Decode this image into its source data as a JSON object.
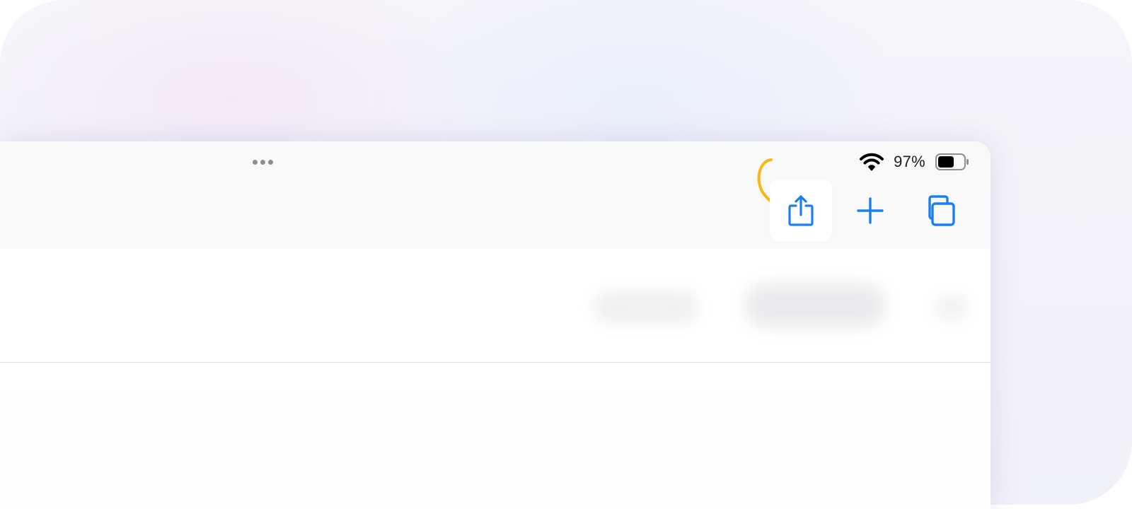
{
  "status_bar": {
    "battery_percent": "97%",
    "battery_level": 0.97,
    "wifi_icon": "wifi-icon",
    "battery_icon": "battery-icon"
  },
  "toolbar": {
    "more_icon": "ellipsis-icon",
    "buttons": [
      {
        "name": "share-button",
        "icon": "share-icon",
        "active": true
      },
      {
        "name": "new-tab-button",
        "icon": "plus-icon",
        "active": false
      },
      {
        "name": "tabs-overview-button",
        "icon": "tabs-icon",
        "active": false
      }
    ]
  },
  "annotation": {
    "icon": "curved-arrow-icon",
    "color": "#fbb614"
  },
  "colors": {
    "accent": "#1a80f0",
    "toolbar_bg": "#f9f9f9"
  }
}
